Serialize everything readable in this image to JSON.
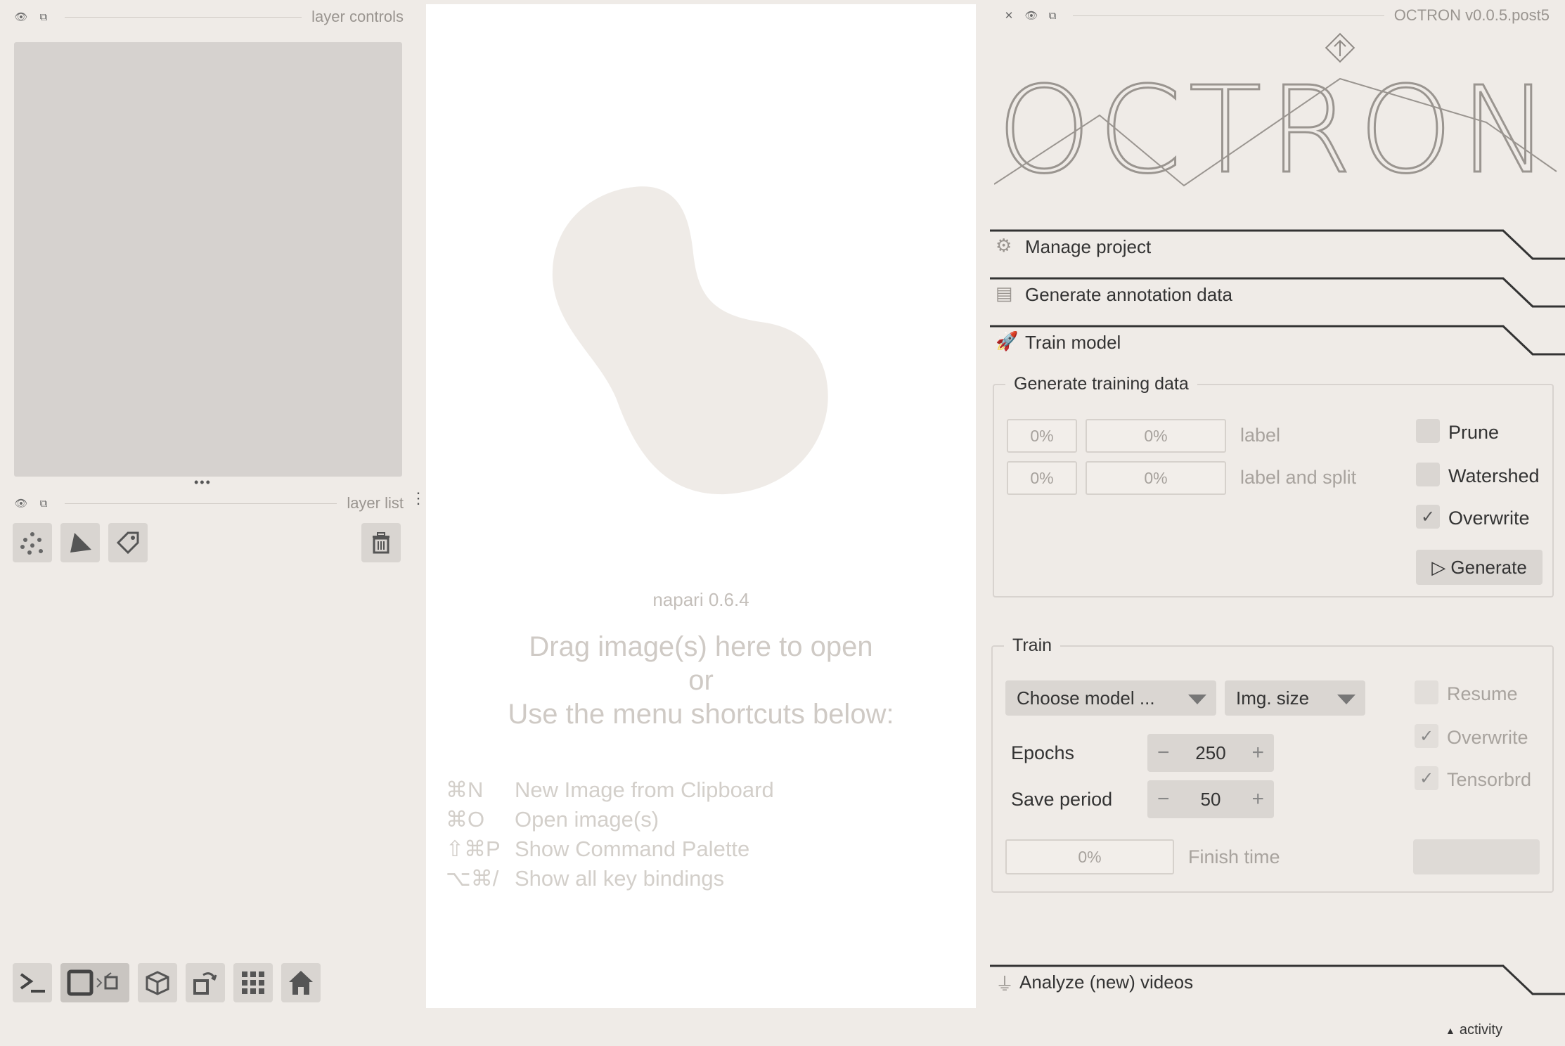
{
  "left_panel": {
    "layer_controls_title": "layer controls",
    "layer_list_title": "layer list",
    "handle_dots": "•••",
    "tools": [
      "points-icon",
      "shapes-icon",
      "labels-icon"
    ],
    "delete_icon": "trash-icon",
    "bottom_buttons": [
      "console-icon",
      "ndisplay-toggle-icon",
      "roll-dims-icon",
      "transpose-icon",
      "grid-icon",
      "home-icon"
    ]
  },
  "canvas": {
    "version": "napari 0.6.4",
    "drag_line1": "Drag image(s) here to open",
    "drag_line2": "or",
    "drag_line3": "Use the menu shortcuts below:",
    "shortcuts": [
      {
        "key": "⌘N",
        "label": "New Image from Clipboard"
      },
      {
        "key": "⌘O",
        "label": "Open image(s)"
      },
      {
        "key": "⇧⌘P",
        "label": "Show Command Palette"
      },
      {
        "key": "⌥⌘/",
        "label": "Show all key bindings"
      }
    ]
  },
  "plugin": {
    "title": "OCTRON v0.0.5.post5",
    "logo_text": "OCTRON",
    "sections": {
      "manage": "Manage project",
      "annotate": "Generate annotation data",
      "train": "Train model",
      "analyze": "Analyze (new) videos"
    },
    "gen_training": {
      "title": "Generate training data",
      "row1": {
        "p1": "0%",
        "p2": "0%",
        "label": "label"
      },
      "row2": {
        "p1": "0%",
        "p2": "0%",
        "label": "label and split"
      },
      "prune": "Prune",
      "watershed": "Watershed",
      "overwrite": "Overwrite",
      "generate_button": "▷ Generate",
      "checks": {
        "prune": false,
        "watershed": false,
        "overwrite": true
      }
    },
    "train": {
      "title": "Train",
      "model_select": "Choose model ...",
      "img_size_select": "Img. size",
      "epochs_label": "Epochs",
      "epochs_value": "250",
      "save_period_label": "Save period",
      "save_period_value": "50",
      "resume": "Resume",
      "overwrite": "Overwrite",
      "tensorbrd": "Tensorbrd",
      "progress": "0%",
      "finish_time_label": "Finish time",
      "checks": {
        "resume": false,
        "overwrite": true,
        "tensorbrd": true
      }
    }
  },
  "status": {
    "activity": "activity"
  }
}
